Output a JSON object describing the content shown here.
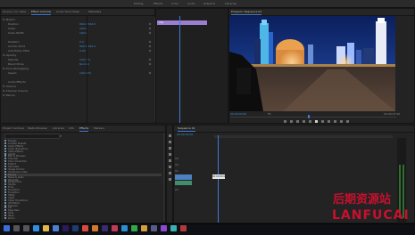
{
  "menu": {
    "tabs": [
      "Editing",
      "Effects",
      "Color",
      "Audio",
      "Graphics",
      "Libraries"
    ]
  },
  "effect_controls": {
    "tabs": [
      "Source: (no clips)",
      "Effect Controls",
      "Audio Track Mixer",
      "Metadata"
    ],
    "rows": [
      {
        "label": "fx  Motion",
        "value": ""
      },
      {
        "label": "Position",
        "value": "960.0   540.0"
      },
      {
        "label": "Scale",
        "value": "100.0"
      },
      {
        "label": "Scale Width",
        "value": "100.0"
      },
      {
        "label": "",
        "value": ""
      },
      {
        "label": "Rotation",
        "value": "0.0"
      },
      {
        "label": "Anchor Point",
        "value": "960.0   540.0"
      },
      {
        "label": "Anti-flicker Filter",
        "value": "0.00"
      },
      {
        "label": "fx  Opacity",
        "value": ""
      },
      {
        "label": "Opacity",
        "value": "100.0 %"
      },
      {
        "label": "Blend Mode",
        "value": "Normal"
      },
      {
        "label": "fx  Time Remapping",
        "value": ""
      },
      {
        "label": "Speed",
        "value": "100.00%"
      },
      {
        "label": "",
        "value": ""
      },
      {
        "label": "Audio Effects",
        "value": ""
      },
      {
        "label": "fx  Volume",
        "value": ""
      },
      {
        "label": "fx  Channel Volume",
        "value": ""
      },
      {
        "label": "fx  Panner",
        "value": ""
      }
    ],
    "clip_label": "clip"
  },
  "program_monitor": {
    "title": "Program: Sequence 01",
    "timecode": "00:00:00:00",
    "fit": "Fit",
    "duration": "00:00:07:20"
  },
  "project": {
    "tabs": [
      "Project: lanfucai",
      "Media Browser",
      "Libraries",
      "Info",
      "Effects",
      "Markers"
    ],
    "items": [
      "Presets",
      "Lumetri Presets",
      "Audio Effects",
      "Audio Transitions",
      "Video Effects",
      "Adjust",
      "Blur & Sharpen",
      "Channel",
      "Color Correction",
      "Distort",
      "Generate",
      "Image Control",
      "Immersive Video",
      "Keying",
      "Noise & Grain",
      "Obsolete",
      "Perspective",
      "Stylize",
      "Time",
      "Transform",
      "Transition",
      "Utility",
      "Video",
      "Video Transitions",
      "3D Motion",
      "Dissolve",
      "Iris",
      "Page Peel",
      "Slide",
      "Wipe",
      "Zoom"
    ]
  },
  "timeline": {
    "tab": "Sequence 01",
    "timecode": "00:00:00:00",
    "tracks": [
      "V3",
      "V2",
      "V1",
      "A1",
      "A2",
      "A3"
    ],
    "clip_tooltip": "00:00:00:00"
  },
  "watermark": {
    "cn": "后期资源站",
    "en": "LANFUCAI"
  },
  "colors": {
    "accent": "#3d7bd9",
    "clip": "#4f7fbf",
    "watermark": "#c8102e"
  }
}
